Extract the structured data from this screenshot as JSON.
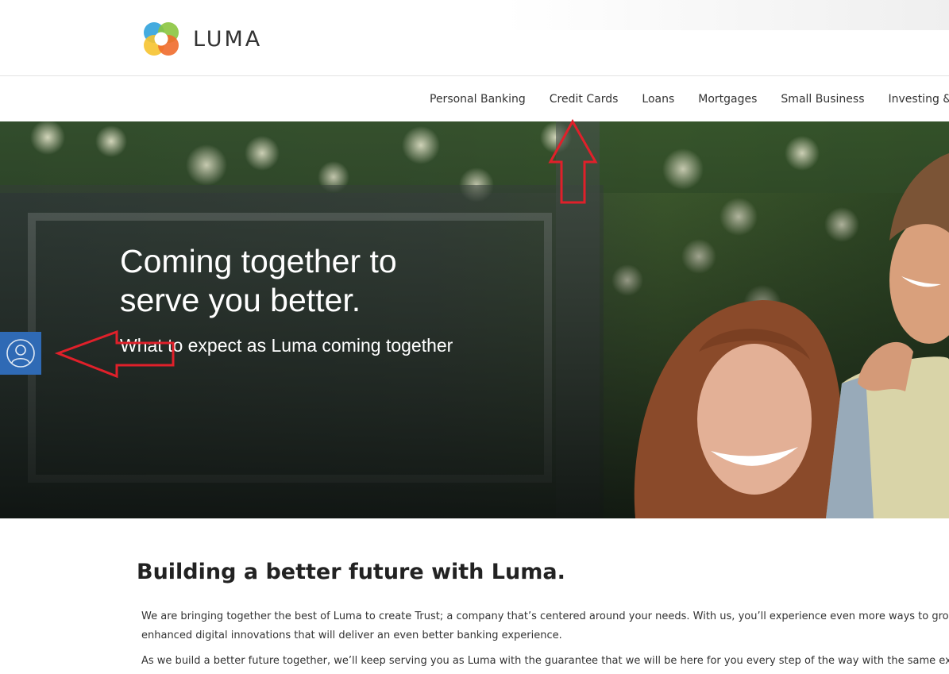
{
  "brand": {
    "name": "LUMA",
    "logo_colors": [
      "#3aa6dd",
      "#8bc53f",
      "#f6c330",
      "#ef6b2c"
    ]
  },
  "nav": {
    "items": [
      {
        "label": "Personal Banking"
      },
      {
        "label": "Credit Cards"
      },
      {
        "label": "Loans"
      },
      {
        "label": "Mortgages"
      },
      {
        "label": "Small Business"
      },
      {
        "label": "Investing & Reti"
      }
    ]
  },
  "hero": {
    "title": "Coming together to serve you better.",
    "subtitle": "What to expect as Luma coming together"
  },
  "side_tab": {
    "icon": "user-icon",
    "color": "#2f6ab5"
  },
  "annotations": {
    "arrow_color": "#e0202a"
  },
  "main": {
    "title": "Building a better future with Luma.",
    "paragraphs": [
      "We are bringing together the best of Luma to create Trust; a company that’s centered around your needs. With us, you’ll experience even more ways to grow you enhanced digital innovations that will deliver an even better banking experience.",
      "As we build a better future together, we’ll keep serving you as Luma with the guarantee that we will be here for you every step of the way with the same except"
    ]
  }
}
